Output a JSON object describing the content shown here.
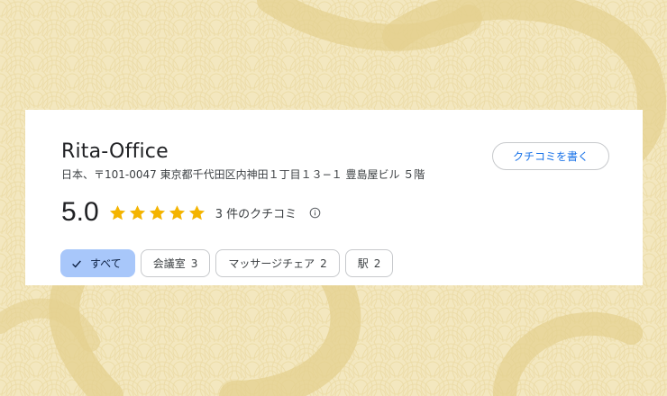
{
  "place": {
    "name": "Rita-Office",
    "address": "日本、〒101-0047 東京都千代田区内神田１丁目１３−１ 豊島屋ビル ５階"
  },
  "actions": {
    "write_review_label": "クチコミを書く"
  },
  "rating": {
    "value": "5.0",
    "stars": 5,
    "star_color": "#f4b400",
    "review_count_label": "3 件のクチコミ",
    "info_icon": "info-icon"
  },
  "filters": [
    {
      "label": "すべて",
      "count": "",
      "selected": true,
      "icon": "check-icon"
    },
    {
      "label": "会議室",
      "count": "3",
      "selected": false
    },
    {
      "label": "マッサージチェア",
      "count": "2",
      "selected": false
    },
    {
      "label": "駅",
      "count": "2",
      "selected": false
    }
  ],
  "colors": {
    "background": "#f3e7bf",
    "card": "#ffffff",
    "accent": "#1a73e8",
    "selected_chip": "#a8c7fa"
  }
}
